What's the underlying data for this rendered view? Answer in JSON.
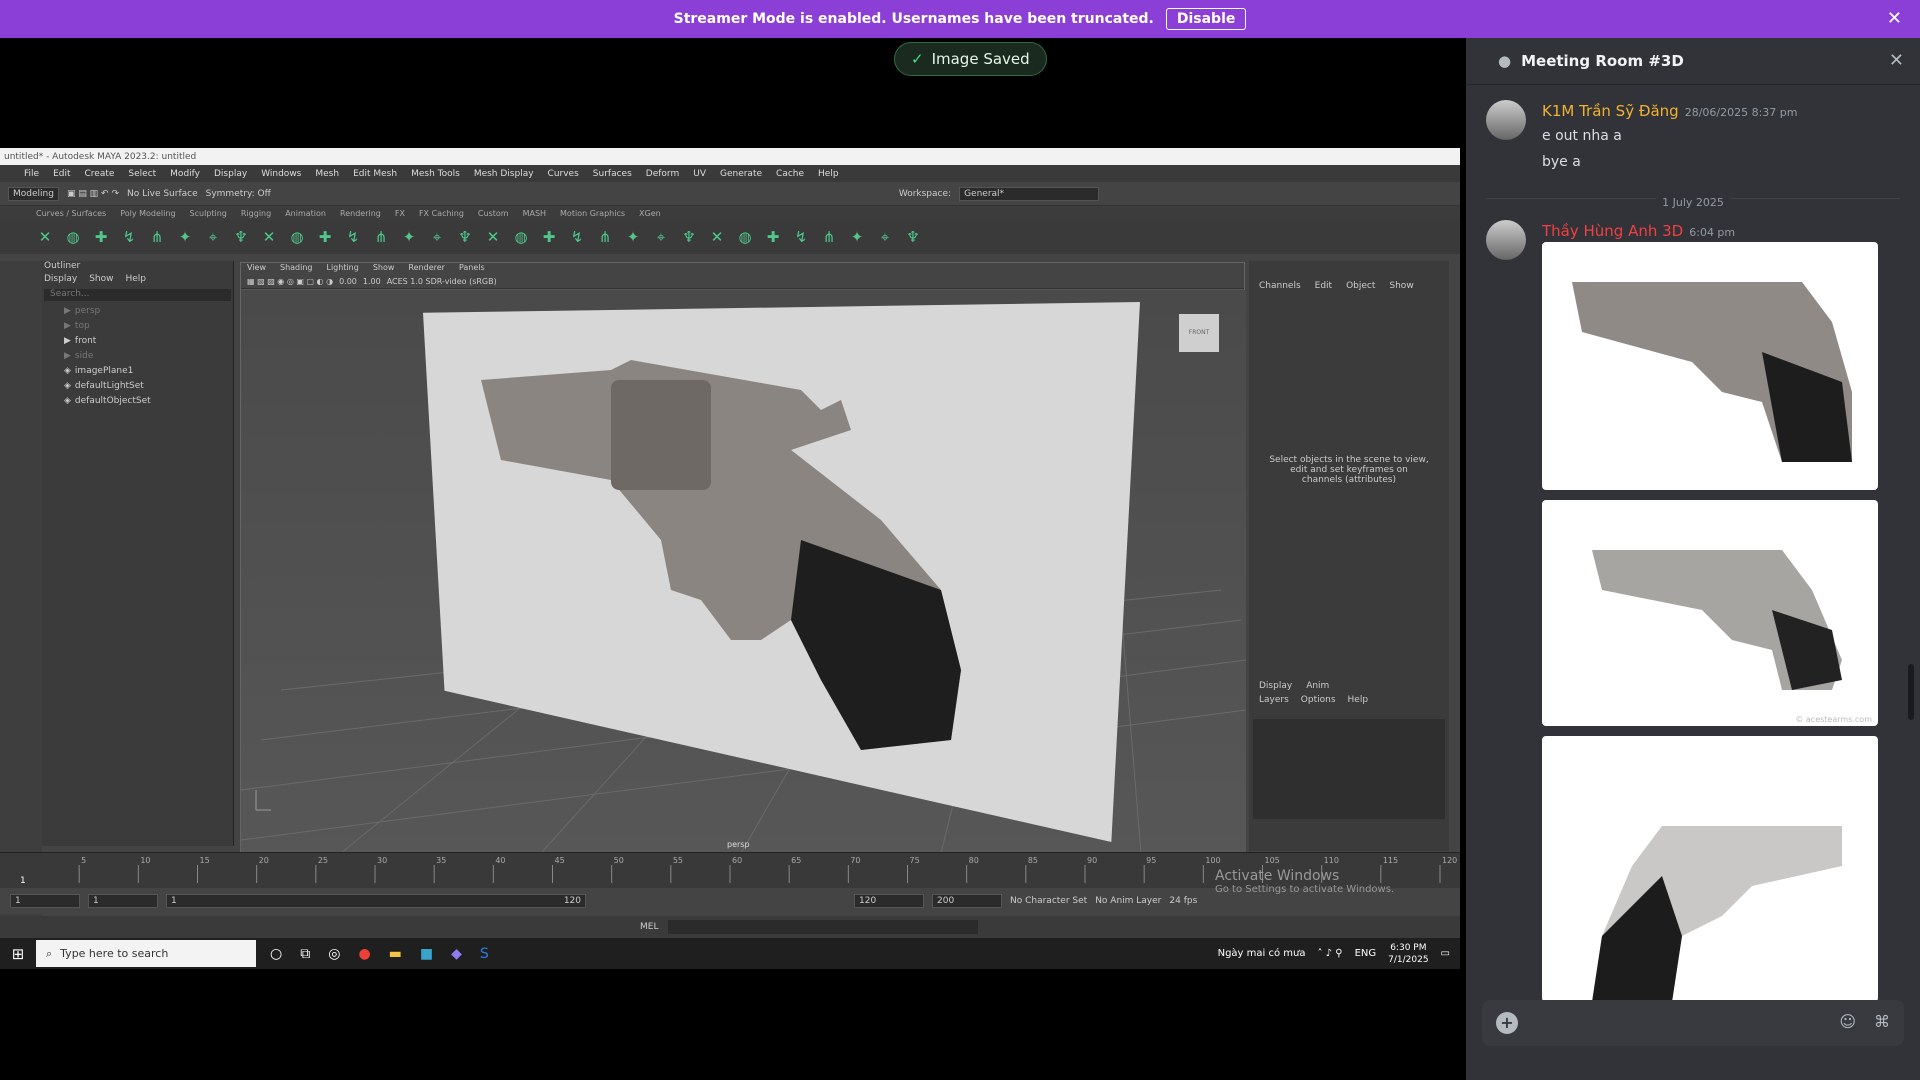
{
  "banner": {
    "text": "Streamer Mode is enabled. Usernames have been truncated.",
    "disable_label": "Disable"
  },
  "toast": {
    "text": "Image Saved"
  },
  "maya": {
    "title": "untitled* - Autodesk MAYA 2023.2: untitled",
    "menu": [
      "File",
      "Edit",
      "Create",
      "Select",
      "Modify",
      "Display",
      "Windows",
      "Mesh",
      "Edit Mesh",
      "Mesh Tools",
      "Mesh Display",
      "Curves",
      "Surfaces",
      "Deform",
      "UV",
      "Generate",
      "Cache",
      "Help"
    ],
    "mode": "Modeling",
    "live_surface": "No Live Surface",
    "symmetry": "Symmetry: Off",
    "workspace_label": "Workspace:",
    "workspace": "General*",
    "shelf_tabs": [
      "Curves / Surfaces",
      "Poly Modeling",
      "Sculpting",
      "Rigging",
      "Animation",
      "Rendering",
      "FX",
      "FX Caching",
      "Custom",
      "MASH",
      "Motion Graphics",
      "XGen"
    ],
    "outliner": {
      "title": "Outliner",
      "menu": [
        "Display",
        "Show",
        "Help"
      ],
      "search": "Search...",
      "items": [
        "persp",
        "top",
        "front",
        "side",
        "imagePlane1",
        "defaultLightSet",
        "defaultObjectSet"
      ]
    },
    "viewport": {
      "menu": [
        "View",
        "Shading",
        "Lighting",
        "Show",
        "Renderer",
        "Panels"
      ],
      "exposure": "0.00",
      "gamma": "1.00",
      "colorspace": "ACES 1.0 SDR-video (sRGB)",
      "camera": "persp",
      "cube": "FRONT"
    },
    "channels": {
      "menu": [
        "Channels",
        "Edit",
        "Object",
        "Show"
      ],
      "message": "Select objects in the scene to view, edit and set keyframes on channels (attributes)",
      "display_tabs": [
        "Display",
        "Anim"
      ],
      "display_menu": [
        "Layers",
        "Options",
        "Help"
      ]
    },
    "timeline": {
      "ticks": [
        "5",
        "10",
        "15",
        "20",
        "25",
        "30",
        "35",
        "40",
        "45",
        "50",
        "55",
        "60",
        "65",
        "70",
        "75",
        "80",
        "85",
        "90",
        "95",
        "100",
        "105",
        "110",
        "115",
        "120"
      ],
      "current": "1"
    },
    "range": {
      "start": "1",
      "inner_start": "1",
      "slider_start": "1",
      "slider_end": "120",
      "end": "120",
      "anim_end": "200",
      "char_set": "No Character Set",
      "anim_layer": "No Anim Layer",
      "fps": "24 fps"
    },
    "mel": "MEL"
  },
  "activate": {
    "title": "Activate Windows",
    "sub": "Go to Settings to activate Windows."
  },
  "taskbar": {
    "search": "Type here to search",
    "weather": "Ngày mai có mưa",
    "lang": "ENG",
    "time": "6:30 PM",
    "date": "7/1/2025"
  },
  "discord": {
    "channel": "Meeting Room #3D",
    "messages": [
      {
        "author": "K1M Trần Sỹ Đăng",
        "author_color": "#f0b232",
        "time": "28/06/2025 8:37 pm",
        "lines": [
          "e out nha a",
          "bye a"
        ]
      },
      {
        "author": "Thầy Hùng Anh 3D",
        "author_color": "#f23f43",
        "time": "6:04 pm",
        "attachments": [
          "revolver-photo-1",
          "revolver-photo-2",
          "revolver-photo-3"
        ]
      }
    ],
    "divider": "1 July 2025",
    "watermark": "© acestearms.com"
  }
}
